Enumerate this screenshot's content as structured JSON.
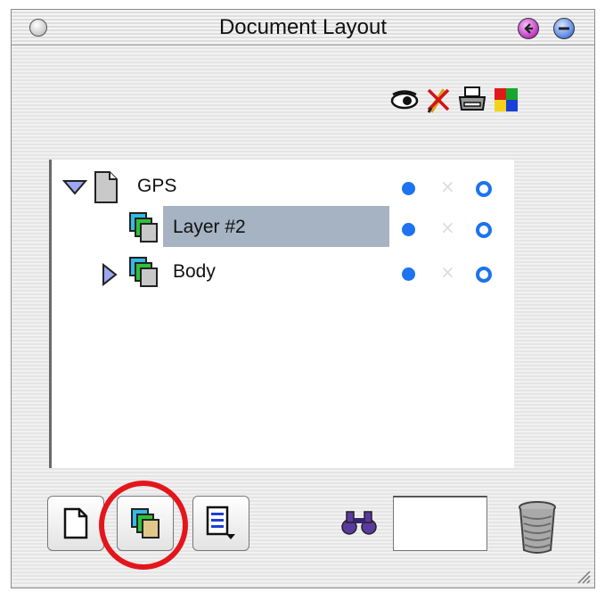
{
  "window": {
    "title": "Document Layout"
  },
  "toolbar": {
    "icons": [
      "eye-icon",
      "pencil-icon",
      "printer-icon",
      "colors-icon"
    ]
  },
  "layers": [
    {
      "label": "GPS",
      "expanded": true,
      "type": "document",
      "visible": true,
      "locked": false,
      "printable": true
    },
    {
      "label": "Layer #2",
      "selected": true,
      "type": "layer",
      "visible": true,
      "locked": false,
      "printable": true
    },
    {
      "label": "Body",
      "expanded": false,
      "type": "layer",
      "visible": true,
      "locked": false,
      "printable": true
    }
  ],
  "bottom_bar": {
    "find_value": "",
    "highlight_color": "#e3161c"
  },
  "colors": {
    "selection": "#a6b3c3",
    "accent": "#1d73f0"
  }
}
